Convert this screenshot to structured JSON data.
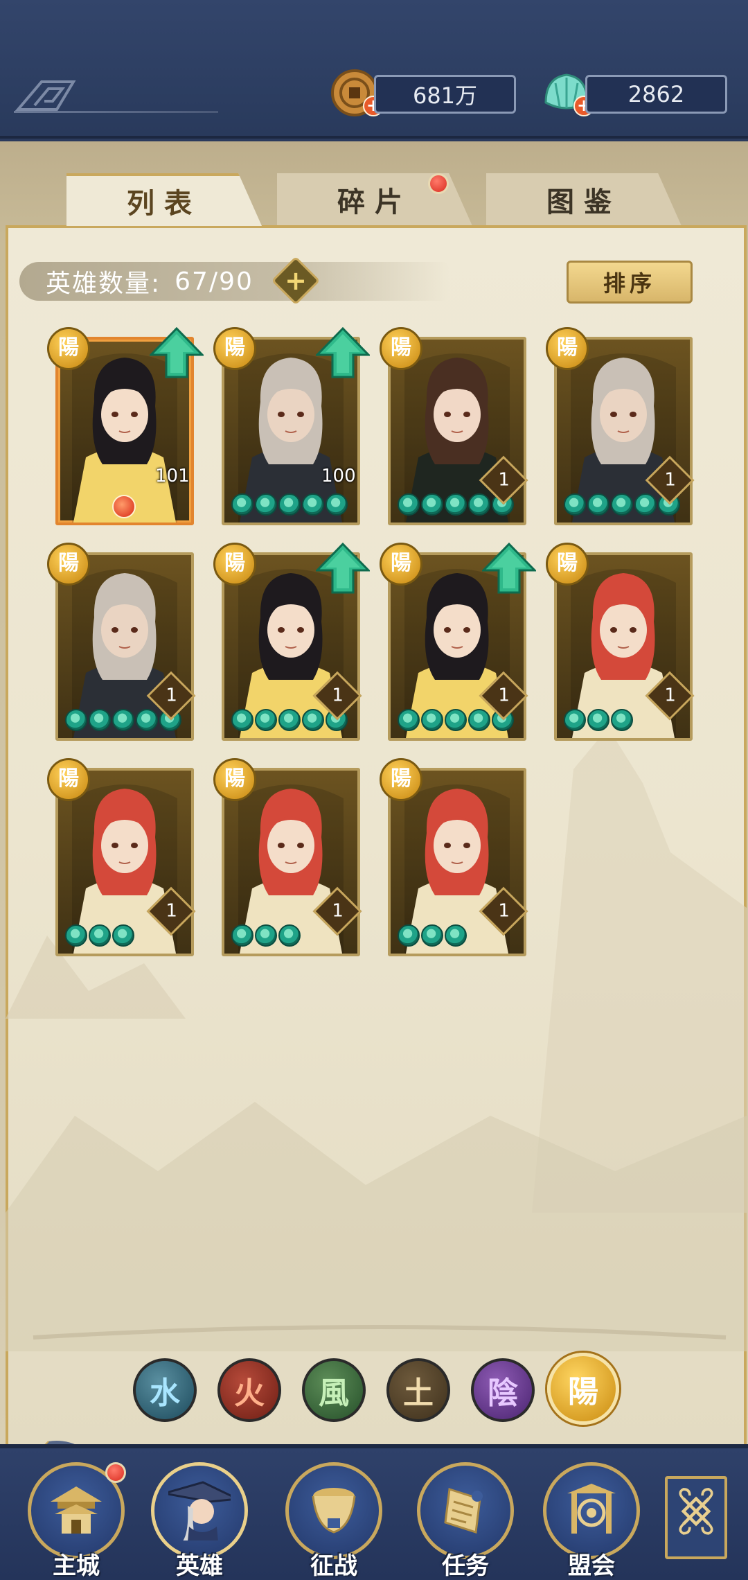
{
  "resources": {
    "coins": "681万",
    "jade": "2862"
  },
  "tabs": [
    {
      "label": "列表",
      "active": true
    },
    {
      "label": "碎片",
      "active": false,
      "badge": true
    },
    {
      "label": "图鉴",
      "active": false
    }
  ],
  "hero_count": {
    "label": "英雄数量:",
    "value": "67/90"
  },
  "sort_button": "排序",
  "heroes": [
    {
      "badge": "陽",
      "level": "101",
      "stars": 0,
      "upgrade": true,
      "frame": "orange",
      "element_gem": "fire"
    },
    {
      "badge": "陽",
      "level": "100",
      "stars": 5,
      "upgrade": true
    },
    {
      "badge": "陽",
      "level": "1",
      "stars": 5,
      "upgrade": false
    },
    {
      "badge": "陽",
      "level": "1",
      "stars": 5,
      "upgrade": false
    },
    {
      "badge": "陽",
      "level": "1",
      "stars": 5,
      "upgrade": false
    },
    {
      "badge": "陽",
      "level": "1",
      "stars": 5,
      "upgrade": true
    },
    {
      "badge": "陽",
      "level": "1",
      "stars": 5,
      "upgrade": true
    },
    {
      "badge": "陽",
      "level": "1",
      "stars": 3,
      "upgrade": false
    },
    {
      "badge": "陽",
      "level": "1",
      "stars": 3,
      "upgrade": false
    },
    {
      "badge": "陽",
      "level": "1",
      "stars": 3,
      "upgrade": false
    },
    {
      "badge": "陽",
      "level": "1",
      "stars": 3,
      "upgrade": false
    }
  ],
  "element_filters": [
    {
      "name": "water",
      "glyph": "水"
    },
    {
      "name": "fire",
      "glyph": "火"
    },
    {
      "name": "wind",
      "glyph": "風"
    },
    {
      "name": "earth",
      "glyph": "土"
    },
    {
      "name": "yin",
      "glyph": "陰"
    },
    {
      "name": "yang",
      "glyph": "陽",
      "selected": true
    }
  ],
  "bottom_nav": [
    {
      "label": "主城",
      "badge": true
    },
    {
      "label": "英雄",
      "active": true
    },
    {
      "label": "征战"
    },
    {
      "label": "任务"
    },
    {
      "label": "盟会"
    }
  ],
  "colors": {
    "header": "#2b3a5c",
    "gold": "#c9a85d",
    "panel": "#efe9d6",
    "star": "#1fa388",
    "alert": "#d92b1f"
  }
}
